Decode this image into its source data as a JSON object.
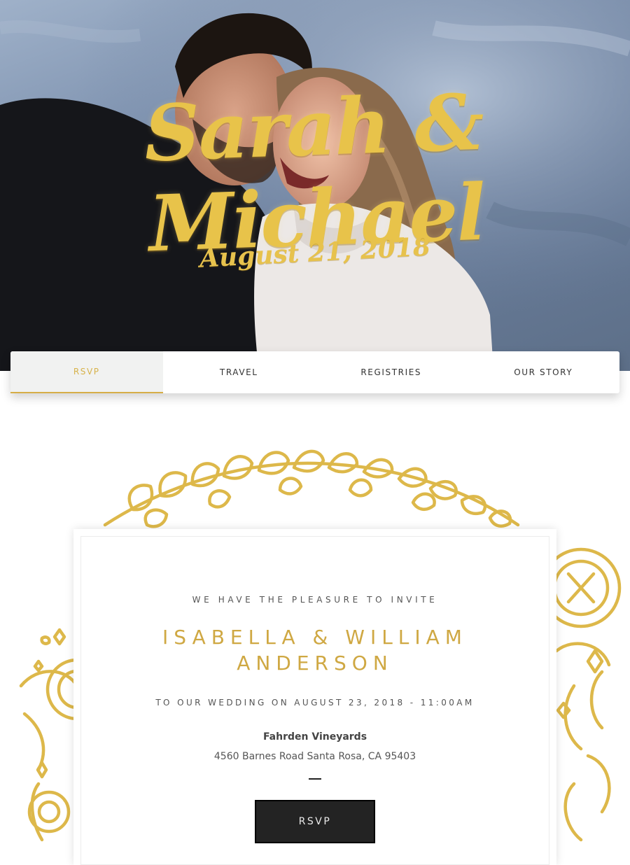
{
  "hero": {
    "names": "Sarah & Michael",
    "date": "August 21, 2018"
  },
  "nav": {
    "tabs": [
      {
        "label": "RSVP",
        "active": true
      },
      {
        "label": "TRAVEL",
        "active": false
      },
      {
        "label": "REGISTRIES",
        "active": false
      },
      {
        "label": "OUR STORY",
        "active": false
      }
    ]
  },
  "invitation": {
    "lead": "WE HAVE THE PLEASURE TO INVITE",
    "couple_line1": "ISABELLA & WILLIAM",
    "couple_line2": "ANDERSON",
    "wedding_line": "TO OUR WEDDING ON AUGUST 23, 2018 - 11:00AM",
    "venue": "Fahrden Vineyards",
    "address": "4560 Barnes Road Santa Rosa, CA 95403",
    "rsvp_label": "RSVP"
  },
  "colors": {
    "gold": "#d6ad47",
    "dark_button": "#232323"
  }
}
